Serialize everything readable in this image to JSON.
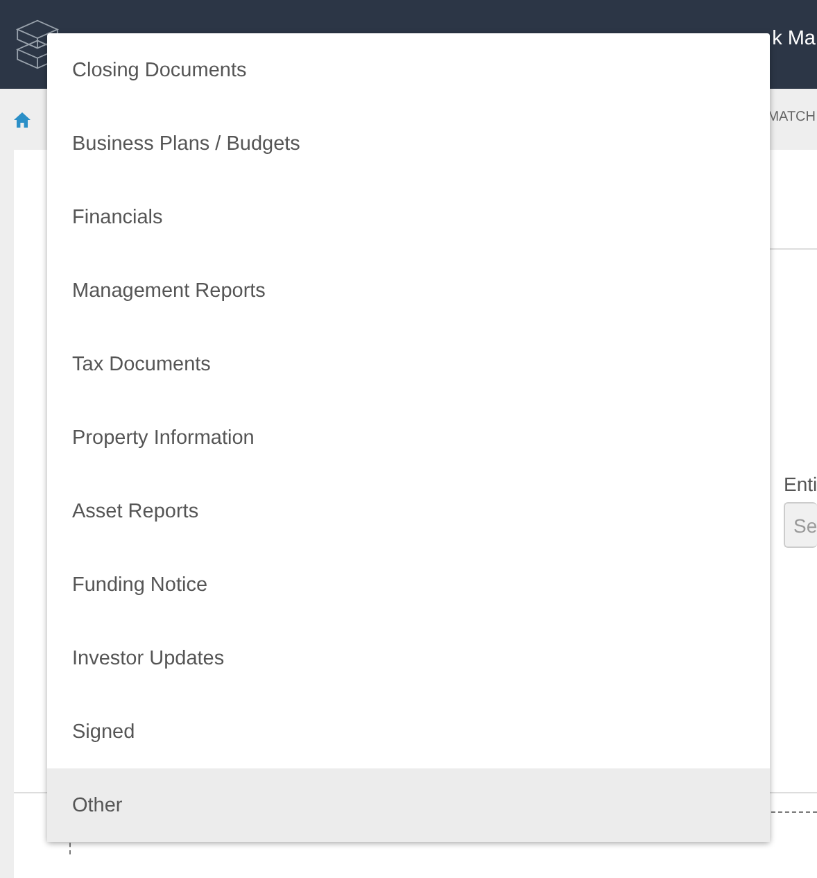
{
  "header": {
    "title_fragment": "k Ma"
  },
  "breadcrumb": {
    "right_fragment": "MATCH"
  },
  "form": {
    "field_label": "Enti",
    "field_placeholder": "Se"
  },
  "menu": {
    "items": [
      {
        "label": "Closing Documents",
        "selected": false
      },
      {
        "label": "Business Plans / Budgets",
        "selected": false
      },
      {
        "label": "Financials",
        "selected": false
      },
      {
        "label": "Management Reports",
        "selected": false
      },
      {
        "label": "Tax Documents",
        "selected": false
      },
      {
        "label": "Property Information",
        "selected": false
      },
      {
        "label": "Asset Reports",
        "selected": false
      },
      {
        "label": "Funding Notice",
        "selected": false
      },
      {
        "label": "Investor Updates",
        "selected": false
      },
      {
        "label": "Signed",
        "selected": false
      },
      {
        "label": "Other",
        "selected": true
      }
    ]
  }
}
